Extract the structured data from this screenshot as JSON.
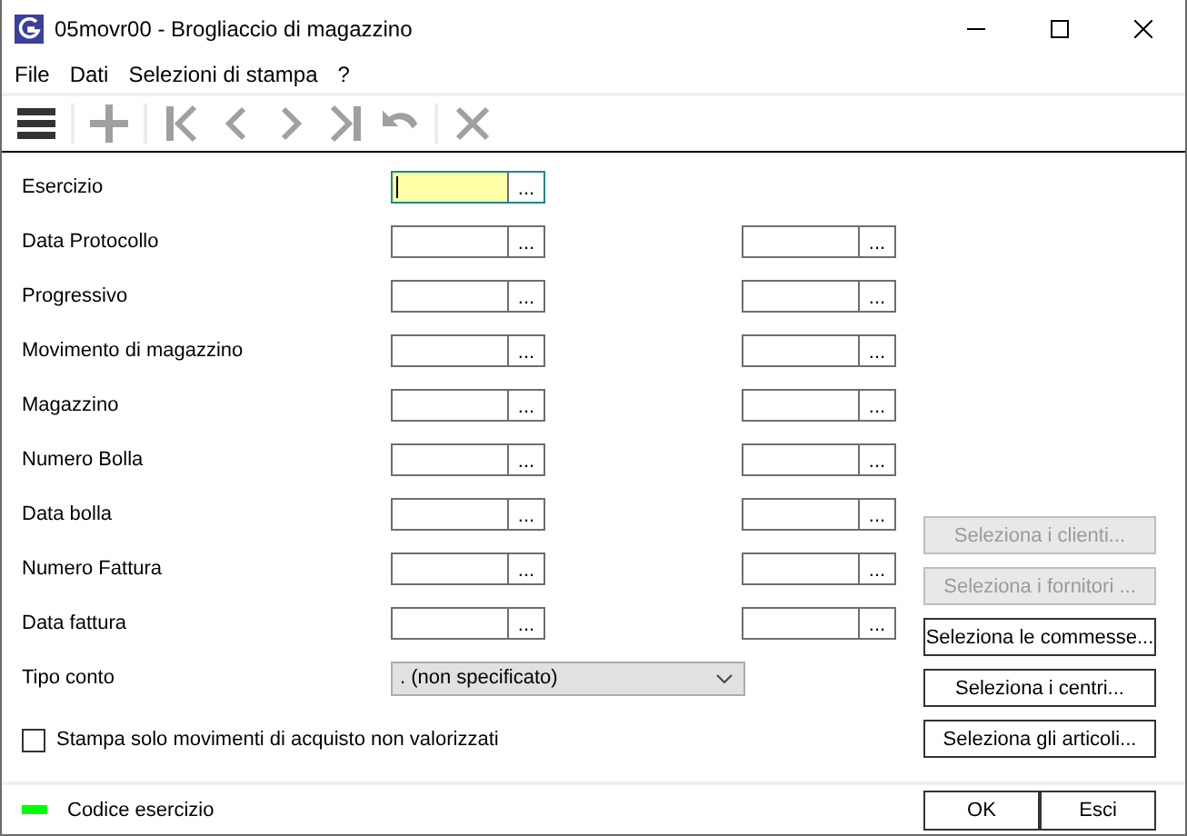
{
  "window": {
    "title": "05movr00 - Brogliaccio di magazzino"
  },
  "menu": [
    "File",
    "Dati",
    "Selezioni di stampa",
    "?"
  ],
  "toolbar": [
    {
      "kind": "menu",
      "disabled": false
    },
    {
      "kind": "separator"
    },
    {
      "kind": "add",
      "disabled": true
    },
    {
      "kind": "separator"
    },
    {
      "kind": "first",
      "disabled": true
    },
    {
      "kind": "prev",
      "disabled": true
    },
    {
      "kind": "next",
      "disabled": true
    },
    {
      "kind": "last",
      "disabled": true
    },
    {
      "kind": "undo",
      "disabled": true
    },
    {
      "kind": "separator"
    },
    {
      "kind": "cancel",
      "disabled": true
    }
  ],
  "fields": [
    {
      "label": "Esercizio",
      "inputs": [
        {
          "button": "...",
          "focused": true
        }
      ]
    },
    {
      "label": "Data Protocollo",
      "inputs": [
        {
          "button": "...",
          "focused": false
        },
        {
          "button": "...",
          "focused": false
        }
      ]
    },
    {
      "label": "Progressivo",
      "inputs": [
        {
          "button": "...",
          "focused": false
        },
        {
          "button": "...",
          "focused": false
        }
      ]
    },
    {
      "label": "Movimento di magazzino",
      "inputs": [
        {
          "button": "...",
          "focused": false
        },
        {
          "button": "...",
          "focused": false
        }
      ]
    },
    {
      "label": "Magazzino",
      "inputs": [
        {
          "button": "...",
          "focused": false
        },
        {
          "button": "...",
          "focused": false
        }
      ]
    },
    {
      "label": "Numero Bolla",
      "inputs": [
        {
          "button": "...",
          "focused": false
        },
        {
          "button": "...",
          "focused": false
        }
      ]
    },
    {
      "label": "Data bolla",
      "inputs": [
        {
          "button": "...",
          "focused": false
        },
        {
          "button": "...",
          "focused": false
        }
      ]
    },
    {
      "label": "Numero Fattura",
      "inputs": [
        {
          "button": "...",
          "focused": false
        },
        {
          "button": "...",
          "focused": false
        }
      ]
    },
    {
      "label": "Data fattura",
      "inputs": [
        {
          "button": "...",
          "focused": false
        },
        {
          "button": "...",
          "focused": false
        }
      ]
    }
  ],
  "tipo_conto": {
    "label": "Tipo conto",
    "value": ". (non specificato)"
  },
  "checkbox": {
    "label": "Stampa solo movimenti di acquisto non valorizzati",
    "checked": false
  },
  "side_buttons": [
    {
      "label": "Seleziona i clienti...",
      "disabled": true
    },
    {
      "label": "Seleziona i fornitori ...",
      "disabled": true
    },
    {
      "label": "Seleziona le commesse...",
      "disabled": false
    },
    {
      "label": "Seleziona i centri...",
      "disabled": false
    },
    {
      "label": "Seleziona gli articoli...",
      "disabled": false
    }
  ],
  "status": {
    "text": "Codice esercizio",
    "color": "#00ff00"
  },
  "buttons": [
    "OK",
    "Esci"
  ]
}
